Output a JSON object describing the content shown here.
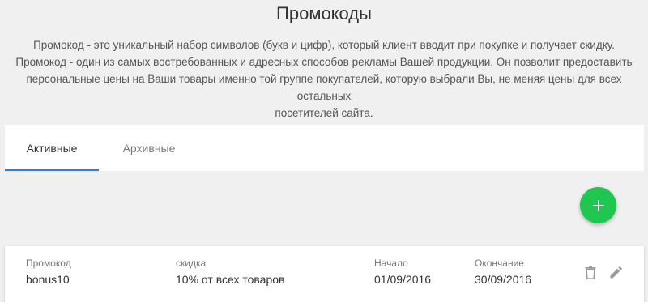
{
  "header": {
    "title": "Промокоды",
    "description": [
      "Промокод - это уникальный набор символов (букв и цифр), который клиент вводит при покупке и получает скидку.",
      "Промокод - один из самых востребованных и адресных способов рекламы Вашей продукции. Он позволит предоставить",
      "персональные цены на Ваши товары именно той группе покупателей, которую выбрали Вы, не меняя цены для всех остальных",
      "посетителей сайта."
    ]
  },
  "tabs": [
    {
      "label": "Активные",
      "active": true
    },
    {
      "label": "Архивные",
      "active": false
    }
  ],
  "colors": {
    "accent": "#2f7fcb",
    "fab": "#1fc64f",
    "background": "#f0f0f0"
  },
  "add_button": {
    "icon": "plus-icon"
  },
  "promo": {
    "code_label": "Промокод",
    "code": "bonus10",
    "discount_label": "скидка",
    "discount": "10% от всех товаров",
    "start_label": "Начало",
    "start": "01/09/2016",
    "end_label": "Окончание",
    "end": "30/09/2016",
    "actions": [
      "trash-icon",
      "pencil-icon"
    ]
  }
}
